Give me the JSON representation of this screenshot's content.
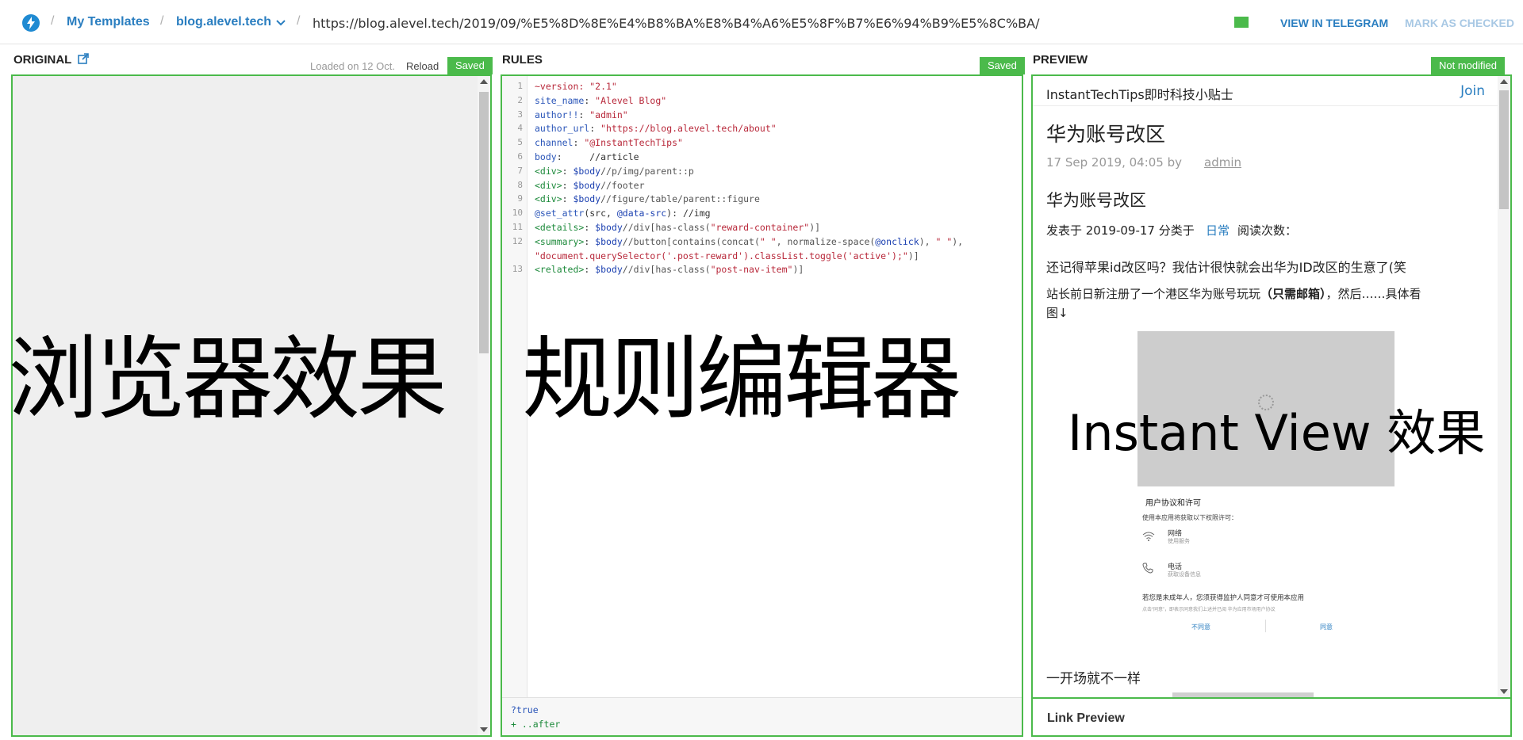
{
  "topbar": {
    "breadcrumb_templates": "My Templates",
    "breadcrumb_domain": "blog.alevel.tech",
    "url": "https://blog.alevel.tech/2019/09/%E5%8D%8E%E4%B8%BA%E8%B4%A6%E5%8F%B7%E6%94%B9%E5%8C%BA/",
    "view_in_telegram": "VIEW IN TELEGRAM",
    "mark_as_checked": "MARK AS CHECKED"
  },
  "original": {
    "title": "ORIGINAL",
    "loaded_text": "Loaded on 12 Oct.",
    "reload": "Reload",
    "badge": "Saved"
  },
  "rules": {
    "title": "RULES",
    "badge": "Saved",
    "footer_line1": "?true",
    "footer_line2": "+ ..after"
  },
  "preview": {
    "title": "PREVIEW",
    "badge": "Not modified",
    "channel": "InstantTechTips即时科技小贴士",
    "join": "Join",
    "article_title": "华为账号改区",
    "meta_date": "17 Sep 2019, 04:05 by",
    "meta_author": "admin",
    "subheading": "华为账号改区",
    "posted_prefix": "发表于 2019-09-17 分类于",
    "category": "日常",
    "posted_suffix": "阅读次数：",
    "para1": "还记得苹果id改区吗？我估计很快就会出华为ID改区的生意了(笑",
    "para2_a": "站长前日新注册了一个港区华为账号玩玩",
    "para2_bold": "（只需邮箱）",
    "para2_b": "，然后……具体看",
    "para2_c": "图↓",
    "img_dialog_title": "用户协议和许可",
    "img_dialog_desc": "使用本应用将获取以下权限许可：",
    "img_perm1": "网络",
    "img_perm1_sub": "使用服务",
    "img_perm2": "电话",
    "img_perm2_sub": "获取设备信息",
    "img_minor_note": "若您是未成年人，您须获得监护人同意才可使用本应用",
    "img_fine_print": "点击“同意”，即表示同意我们上述并已阅 华为应用市场用户协议",
    "img_disagree": "不同意",
    "img_agree": "同意",
    "para3": "一开场就不一样",
    "link_preview": "Link Preview"
  },
  "overlays": {
    "browser_effect": "浏览器效果",
    "rule_editor": "规则编辑器",
    "iv_effect": "Instant View 效果"
  },
  "code_lines": [
    {
      "n": "1",
      "parts": [
        [
          "str",
          "~version: \"2.1\""
        ]
      ]
    },
    {
      "n": "2",
      "parts": [
        [
          "kw",
          "site_name"
        ],
        [
          "",
          ": "
        ],
        [
          "str",
          "\"Alevel Blog\""
        ]
      ]
    },
    {
      "n": "3",
      "parts": [
        [
          "kw",
          "author!!"
        ],
        [
          "",
          ": "
        ],
        [
          "str",
          "\"admin\""
        ]
      ]
    },
    {
      "n": "4",
      "parts": [
        [
          "kw",
          "author_url"
        ],
        [
          "",
          ": "
        ],
        [
          "str",
          "\"https://blog.alevel.tech/about\""
        ]
      ]
    },
    {
      "n": "5",
      "parts": [
        [
          "kw",
          "channel"
        ],
        [
          "",
          ": "
        ],
        [
          "str",
          "\"@InstantTechTips\""
        ]
      ]
    },
    {
      "n": "6",
      "parts": [
        [
          "kw",
          "body"
        ],
        [
          "",
          ":     //article"
        ]
      ]
    },
    {
      "n": "7",
      "parts": [
        [
          "tag",
          "<div>"
        ],
        [
          "",
          ": "
        ],
        [
          "var",
          "$body"
        ],
        [
          "path",
          "//p/img/parent::p"
        ]
      ]
    },
    {
      "n": "8",
      "parts": [
        [
          "tag",
          "<div>"
        ],
        [
          "",
          ": "
        ],
        [
          "var",
          "$body"
        ],
        [
          "path",
          "//footer"
        ]
      ]
    },
    {
      "n": "9",
      "parts": [
        [
          "tag",
          "<div>"
        ],
        [
          "",
          ": "
        ],
        [
          "var",
          "$body"
        ],
        [
          "path",
          "//figure/table/parent::figure"
        ]
      ]
    },
    {
      "n": "10",
      "parts": [
        [
          "kw",
          "@set_attr"
        ],
        [
          "",
          "(src, "
        ],
        [
          "var",
          "@data-src"
        ],
        [
          "",
          "): //img"
        ]
      ]
    },
    {
      "n": "11",
      "parts": [
        [
          "tag",
          "<details>"
        ],
        [
          "",
          ": "
        ],
        [
          "var",
          "$body"
        ],
        [
          "path",
          "//div[has-class("
        ],
        [
          "str",
          "\"reward-container\""
        ],
        [
          "path",
          ")]"
        ]
      ]
    },
    {
      "n": "12",
      "parts": [
        [
          "tag",
          "<summary>"
        ],
        [
          "",
          ": "
        ],
        [
          "var",
          "$body"
        ],
        [
          "path",
          "//button[contains(concat("
        ],
        [
          "str",
          "\" \""
        ],
        [
          "path",
          ", normalize-space("
        ],
        [
          "var",
          "@onclick"
        ],
        [
          "path",
          "), "
        ],
        [
          "str",
          "\" \""
        ],
        [
          "path",
          "),"
        ]
      ]
    },
    {
      "n": "",
      "parts": [
        [
          "str",
          "\"document.querySelector('.post-reward').classList.toggle('active');\""
        ],
        [
          "path",
          ")]"
        ]
      ]
    },
    {
      "n": "13",
      "parts": [
        [
          "tag",
          "<related>"
        ],
        [
          "",
          ": "
        ],
        [
          "var",
          "$body"
        ],
        [
          "path",
          "//div[has-class("
        ],
        [
          "str",
          "\"post-nav-item\""
        ],
        [
          "path",
          ")]"
        ]
      ]
    }
  ],
  "colors": {
    "accent_green": "#4bba4b",
    "link_blue": "#2a7ec0"
  }
}
